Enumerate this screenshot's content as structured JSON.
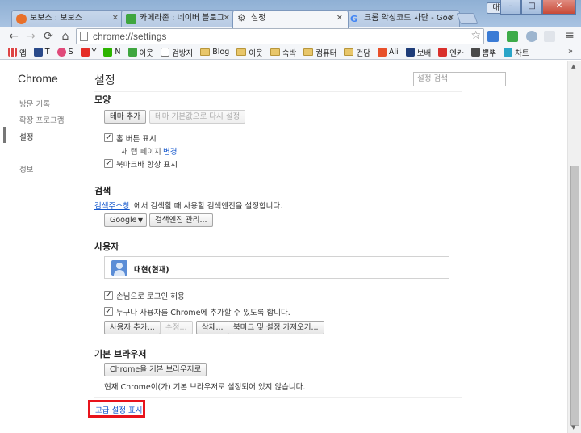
{
  "window": {
    "profile_name": "대현",
    "minimize": "–",
    "maximize": "□",
    "close": "✕"
  },
  "tabs": [
    {
      "title": "보보스 : 보보스",
      "favicon_color": "#e8702a",
      "active": false
    },
    {
      "title": "카메라존 : 네이버 블로그",
      "favicon_color": "#3fa63f",
      "active": false
    },
    {
      "title": "설정",
      "favicon_color": "#666666",
      "active": true
    },
    {
      "title": "크롬 악성코드 차단 - Goo",
      "favicon_color": "#4285f4",
      "active": false
    }
  ],
  "toolbar": {
    "url": "chrome://settings",
    "back_icon": "←",
    "forward_icon": "→",
    "reload_icon": "⟳",
    "home_icon": "⌂",
    "star_icon": "☆",
    "menu_icon": "≡"
  },
  "bookmarks": [
    {
      "label": "앱",
      "type": "apps",
      "color": "#d44"
    },
    {
      "label": "T",
      "type": "icon",
      "color": "#2a4a8a"
    },
    {
      "label": "S",
      "type": "icon",
      "color": "#e04a7a"
    },
    {
      "label": "Y",
      "type": "icon",
      "color": "#e52d27"
    },
    {
      "label": "N",
      "type": "icon",
      "color": "#2db400"
    },
    {
      "label": "이웃",
      "type": "icon",
      "color": "#3fa63f"
    },
    {
      "label": "검방지",
      "type": "icon",
      "color": "#555555"
    },
    {
      "label": "Blog",
      "type": "folder",
      "color": ""
    },
    {
      "label": "이웃",
      "type": "folder",
      "color": ""
    },
    {
      "label": "숙박",
      "type": "folder",
      "color": ""
    },
    {
      "label": "컴퓨터",
      "type": "folder",
      "color": ""
    },
    {
      "label": "건담",
      "type": "folder",
      "color": ""
    },
    {
      "label": "Ali",
      "type": "icon",
      "color": "#e8502a"
    },
    {
      "label": "보배",
      "type": "icon",
      "color": "#1e3c78"
    },
    {
      "label": "엔카",
      "type": "icon",
      "color": "#d9302b"
    },
    {
      "label": "뽐뿌",
      "type": "icon",
      "color": "#4a4a4a"
    },
    {
      "label": "차트",
      "type": "icon",
      "color": "#2aa5c8"
    }
  ],
  "bookmarks_more": "»",
  "sidebar": {
    "title": "Chrome",
    "items": [
      {
        "label": "방문 기록"
      },
      {
        "label": "확장 프로그램"
      },
      {
        "label": "설정"
      },
      {
        "label": "정보"
      }
    ]
  },
  "settings": {
    "title": "설정",
    "search_placeholder": "설정 검색",
    "appearance": {
      "title": "모양",
      "get_themes": "테마 추가",
      "reset_theme": "테마 기본값으로 다시 설정",
      "show_home": "홈 버튼 표시",
      "new_tab_prefix": "새 탭 페이지",
      "change": "변경",
      "show_bookmarks": "북마크바 항상 표시"
    },
    "search": {
      "title": "검색",
      "link": "검색주소창",
      "desc": "에서 검색할 때 사용할 검색엔진을 설정합니다.",
      "engine": "Google",
      "manage": "검색엔진 관리..."
    },
    "people": {
      "title": "사용자",
      "current_user": "대현(현재)",
      "guest": "손님으로 로그인 허용",
      "anyone_add": "누구나 사용자를 Chrome에 추가할 수 있도록 합니다.",
      "add": "사용자 추가...",
      "edit": "수정...",
      "remove": "삭제...",
      "import": "북마크 및 설정 가져오기..."
    },
    "default_browser": {
      "title": "기본 브라우저",
      "make_default": "Chrome을 기본 브라우저로",
      "status": "현재 Chrome이(가) 기본 브라우저로 설정되어 있지 않습니다."
    },
    "show_advanced": "고급 설정 표시",
    "highlight_color": "#e8141c"
  }
}
